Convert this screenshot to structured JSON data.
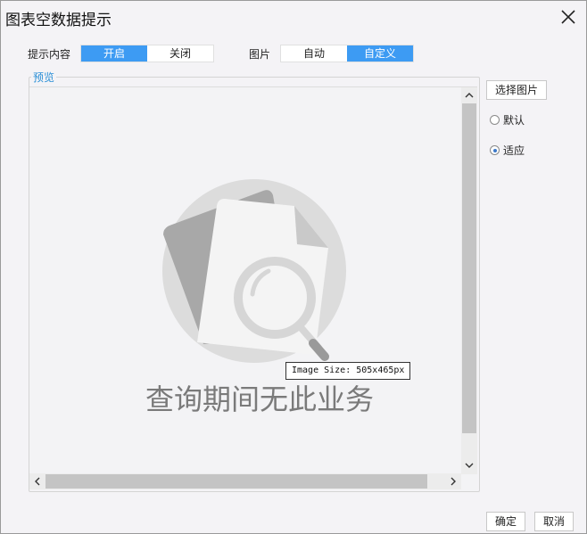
{
  "window": {
    "title": "图表空数据提示"
  },
  "options": {
    "prompt_label": "提示内容",
    "prompt_on": "开启",
    "prompt_off": "关闭",
    "prompt_selected": "开启",
    "image_label": "图片",
    "image_auto": "自动",
    "image_custom": "自定义",
    "image_selected": "自定义"
  },
  "preview": {
    "legend": "预览",
    "empty_text": "查询期间无此业务",
    "tooltip": "Image Size: 505x465px"
  },
  "side": {
    "choose_image": "选择图片",
    "radio_default": "默认",
    "radio_fit": "适应",
    "radio_selected": "适应"
  },
  "footer": {
    "ok": "确定",
    "cancel": "取消"
  },
  "colors": {
    "accent": "#3d9bf3",
    "legend": "#2a8fd6",
    "illustration_circle": "#dcdcdc",
    "illustration_dark": "#a8a8a8"
  }
}
